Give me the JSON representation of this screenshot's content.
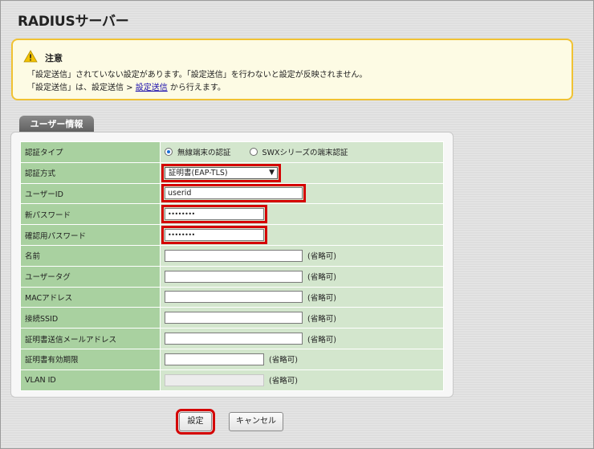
{
  "page": {
    "title": "RADIUSサーバー"
  },
  "notice": {
    "title": "注意",
    "line1": "「設定送信」されていない設定があります。「設定送信」を行わないと設定が反映されません。",
    "line2_prefix": "「設定送信」は、設定送信 > ",
    "line2_link": "設定送信",
    "line2_suffix": " から行えます。"
  },
  "section": {
    "tab_label": "ユーザー情報"
  },
  "form": {
    "auth_type": {
      "label": "認証タイプ",
      "option1": "無線端末の認証",
      "option2": "SWXシリーズの端末認証",
      "selected": "無線端末の認証"
    },
    "auth_method": {
      "label": "認証方式",
      "value": "証明書(EAP-TLS)"
    },
    "user_id": {
      "label": "ユーザーID",
      "value": "userid"
    },
    "new_password": {
      "label": "新パスワード",
      "value": "••••••••"
    },
    "confirm_password": {
      "label": "確認用パスワード",
      "value": "••••••••"
    },
    "name": {
      "label": "名前",
      "value": "",
      "optional": "(省略可)"
    },
    "user_tag": {
      "label": "ユーザータグ",
      "value": "",
      "optional": "(省略可)"
    },
    "mac_address": {
      "label": "MACアドレス",
      "value": "",
      "optional": "(省略可)"
    },
    "ssid": {
      "label": "接続SSID",
      "value": "",
      "optional": "(省略可)"
    },
    "cert_email": {
      "label": "証明書送信メールアドレス",
      "value": "",
      "optional": "(省略可)"
    },
    "cert_expiry": {
      "label": "証明書有効期限",
      "value": "",
      "optional": "(省略可)"
    },
    "vlan_id": {
      "label": "VLAN ID",
      "value": "",
      "optional": "(省略可)"
    }
  },
  "buttons": {
    "save": "設定",
    "cancel": "キャンセル"
  },
  "colors": {
    "highlight": "#d40000",
    "label_bg": "#a9d1a0",
    "value_bg": "#d3e6cd",
    "notice_border": "#f0c233"
  }
}
